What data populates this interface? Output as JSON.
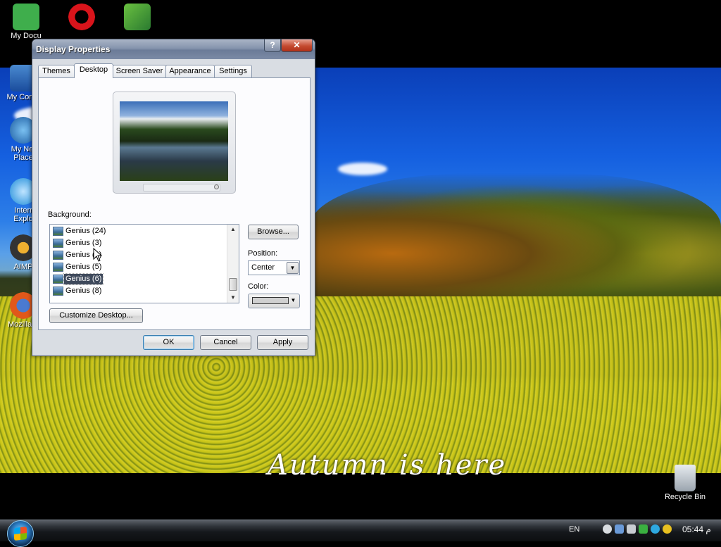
{
  "desktop": {
    "icons": [
      {
        "label": "My Docu",
        "icon": "my-documents-icon",
        "color": "#3fae4c"
      },
      {
        "label": "",
        "icon": "opera-icon",
        "color": "#d9141b"
      },
      {
        "label": "",
        "icon": "media-icon",
        "color": "#5aa83a"
      },
      {
        "label": "My Comp",
        "icon": "my-computer-icon",
        "color": "#1a4c9c"
      },
      {
        "label": "My Net",
        "label2": "Place",
        "icon": "network-icon",
        "color": "#2a7ad0"
      },
      {
        "label": "Interr",
        "label2": "Explo",
        "icon": "internet-explorer-icon",
        "color": "#1a8ad8"
      },
      {
        "label": "AIMP",
        "icon": "aimp-icon",
        "color": "#f0a020"
      },
      {
        "label": "Mozilla F",
        "icon": "firefox-icon",
        "color": "#e0581a"
      }
    ],
    "recycle_bin": "Recycle Bin",
    "wallpaper_caption": "Autumn is here"
  },
  "window": {
    "title": "Display Properties",
    "help_glyph": "?",
    "close_glyph": "✕",
    "tabs": [
      "Themes",
      "Desktop",
      "Screen Saver",
      "Appearance",
      "Settings"
    ],
    "active_tab": "Desktop",
    "background_label": "Background:",
    "background_items": [
      "Genius (24)",
      "Genius (3)",
      "Genius (4)",
      "Genius (5)",
      "Genius (6)",
      "Genius (8)"
    ],
    "selected_background": "Genius (6)",
    "browse_label": "Browse...",
    "position_label": "Position:",
    "position_value": "Center",
    "color_label": "Color:",
    "color_value": "#d0d0d0",
    "customize_label": "Customize Desktop...",
    "ok_label": "OK",
    "cancel_label": "Cancel",
    "apply_label": "Apply"
  },
  "taskbar": {
    "language": "EN",
    "clock": "05:44 م",
    "tray_icons": [
      "network-icon",
      "shield-icon",
      "volume-icon",
      "update-icon",
      "skype-icon",
      "messenger-icon"
    ]
  }
}
